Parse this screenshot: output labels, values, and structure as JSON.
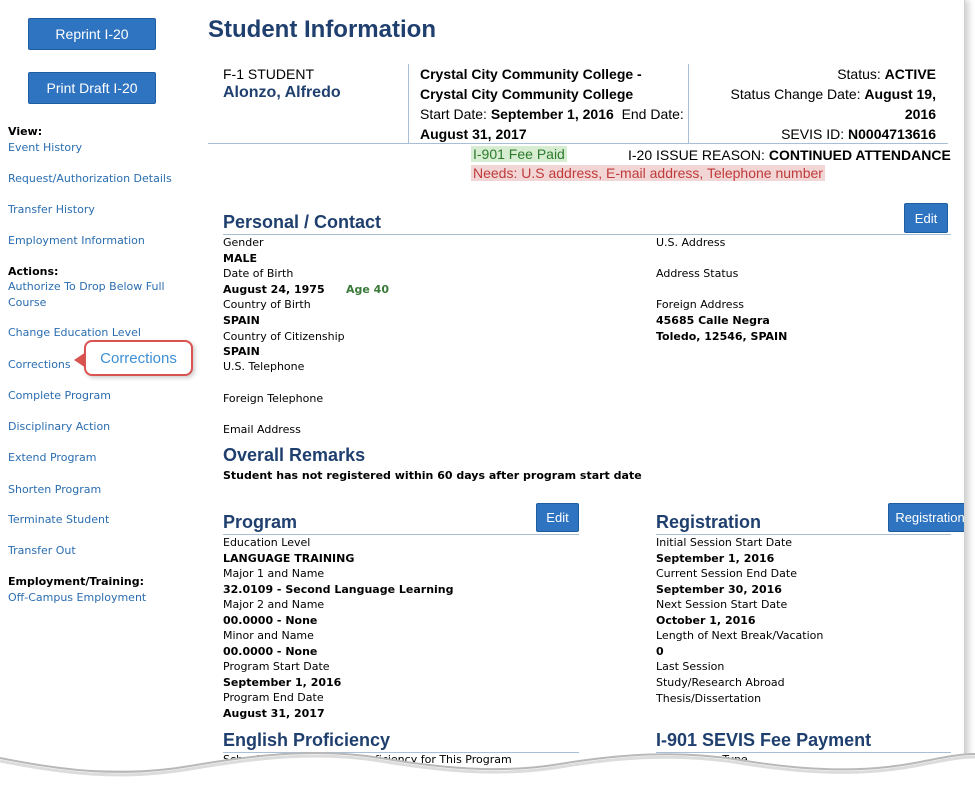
{
  "sidebar": {
    "reprint_label": "Reprint I-20",
    "print_draft_label": "Print Draft I-20",
    "view_heading": "View:",
    "view_items": [
      "Event History",
      "Request/Authorization Details",
      "Transfer History",
      "Employment Information"
    ],
    "actions_heading": "Actions:",
    "action_items": [
      "Authorize To Drop Below Full",
      "Course",
      "Change Education Level",
      "Corrections",
      "Complete Program",
      "Disciplinary Action",
      "Extend Program",
      "Shorten Program",
      "Terminate Student",
      "Transfer Out"
    ],
    "employment_heading": "Employment/Training:",
    "employment_items": [
      "Off-Campus Employment"
    ],
    "callout": "Corrections"
  },
  "page": {
    "title": "Student Information"
  },
  "header": {
    "student_type": "F-1 STUDENT",
    "student_name": "Alonzo, Alfredo",
    "school_line1": "Crystal City Community College -",
    "school_line2": "Crystal City Community College",
    "start_label": "Start Date: ",
    "start_value": "September 1, 2016",
    "end_label": "End Date:",
    "end_value": "August 31, 2017",
    "status_label": "Status: ",
    "status_value": "ACTIVE",
    "status_change_label": "Status Change Date: ",
    "status_change_value1": "August 19,",
    "status_change_value2": "2016",
    "sevis_label": "SEVIS ID: ",
    "sevis_value": "N0004713616",
    "fee_badge": "I-901 Fee Paid",
    "issue_label": "I-20 ISSUE REASON: ",
    "issue_value": "CONTINUED ATTENDANCE",
    "needs": "Needs: U.S address, E-mail address, Telephone number"
  },
  "personal": {
    "title": "Personal / Contact",
    "edit_label": "Edit",
    "gender_label": "Gender",
    "gender_value": "MALE",
    "dob_label": "Date of Birth",
    "dob_value": "August 24, 1975",
    "age": "Age 40",
    "cob_label": "Country of Birth",
    "cob_value": "SPAIN",
    "coc_label": "Country of Citizenship",
    "coc_value": "SPAIN",
    "us_tel_label": "U.S. Telephone",
    "foreign_tel_label": "Foreign Telephone",
    "email_label": "Email Address",
    "us_address_label": "U.S. Address",
    "address_status_label": "Address Status",
    "foreign_address_label": "Foreign Address",
    "foreign_address_line1": "45685 Calle Negra",
    "foreign_address_line2": "Toledo,  12546,  SPAIN"
  },
  "remarks": {
    "title": "Overall Remarks",
    "text": "Student has not registered within 60 days after program start date"
  },
  "program": {
    "title": "Program",
    "edit_label": "Edit",
    "rows": [
      {
        "label": "Education Level",
        "value": "LANGUAGE TRAINING"
      },
      {
        "label": "Major 1 and Name",
        "value": "32.0109 - Second Language Learning"
      },
      {
        "label": "Major 2 and Name",
        "value": "00.0000 - None"
      },
      {
        "label": "Minor and Name",
        "value": "00.0000 - None"
      },
      {
        "label": "Program Start Date",
        "value": "September 1, 2016"
      },
      {
        "label": "Program End Date",
        "value": "August 31, 2017"
      }
    ]
  },
  "registration": {
    "title": "Registration",
    "button_label": "Registration",
    "rows": [
      {
        "label": "Initial Session Start Date",
        "value": "September 1, 2016"
      },
      {
        "label": "Current Session End Date",
        "value": "September 30, 2016"
      },
      {
        "label": "Next Session Start Date",
        "value": "October 1, 2016"
      },
      {
        "label": "Length of Next Break/Vacation",
        "value": "0"
      }
    ],
    "last_session_label": "Last Session",
    "study_abroad_label": "Study/Research Abroad",
    "thesis_label": "Thesis/Dissertation"
  },
  "english": {
    "title": "English Proficiency",
    "row_label": "School Requires English Proficiency for This Program"
  },
  "fee_payment": {
    "title": "I-901 SEVIS Fee Payment",
    "row_label": "Transaction Type"
  }
}
